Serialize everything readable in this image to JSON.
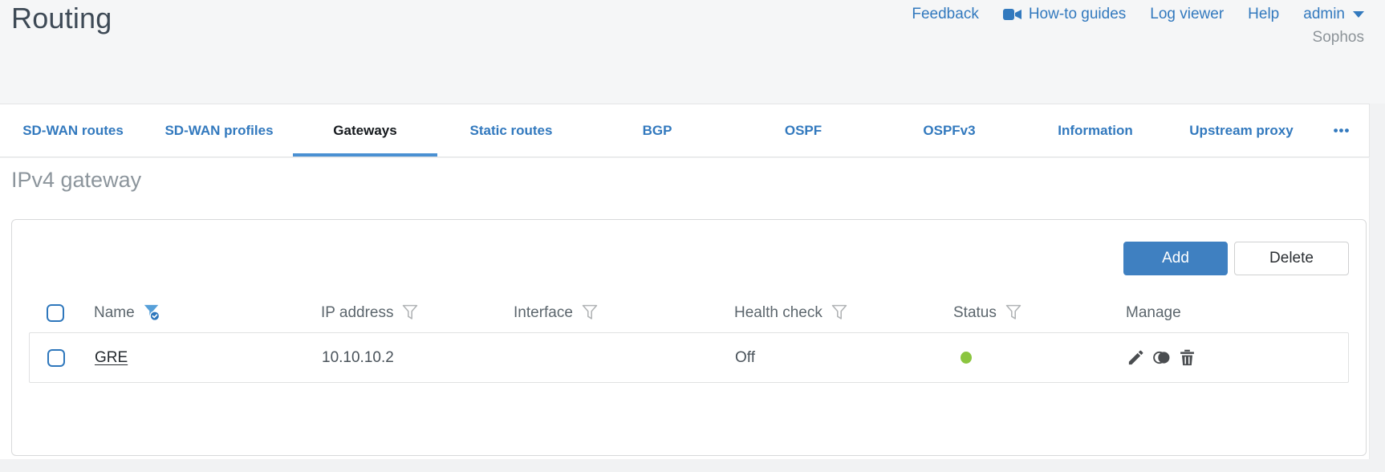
{
  "page": {
    "title": "Routing",
    "brand": "Sophos"
  },
  "header_links": {
    "feedback": "Feedback",
    "howto": "How-to guides",
    "log_viewer": "Log viewer",
    "help": "Help",
    "user": "admin"
  },
  "tabs": [
    {
      "label": "SD-WAN routes",
      "active": false
    },
    {
      "label": "SD-WAN profiles",
      "active": false
    },
    {
      "label": "Gateways",
      "active": true
    },
    {
      "label": "Static routes",
      "active": false
    },
    {
      "label": "BGP",
      "active": false
    },
    {
      "label": "OSPF",
      "active": false
    },
    {
      "label": "OSPFv3",
      "active": false
    },
    {
      "label": "Information",
      "active": false
    },
    {
      "label": "Upstream proxy",
      "active": false
    }
  ],
  "tabs_overflow": "•••",
  "section": {
    "title": "IPv4 gateway"
  },
  "toolbar": {
    "add_label": "Add",
    "delete_label": "Delete"
  },
  "table": {
    "columns": [
      {
        "label": "Name",
        "filter": "active"
      },
      {
        "label": "IP address",
        "filter": "inactive"
      },
      {
        "label": "Interface",
        "filter": "inactive"
      },
      {
        "label": "Health check",
        "filter": "inactive"
      },
      {
        "label": "Status",
        "filter": "inactive"
      },
      {
        "label": "Manage",
        "filter": "none"
      }
    ],
    "rows": [
      {
        "name": "GRE",
        "ip_address": "10.10.10.2",
        "interface": "",
        "health_check": "Off",
        "status": "up"
      }
    ]
  },
  "icons": {
    "howto": "video-camera-icon",
    "filter_active": "funnel-check-icon",
    "filter": "funnel-icon",
    "manage": [
      "edit-pencil-icon",
      "clone-icon",
      "delete-trash-icon"
    ]
  },
  "colors": {
    "accent_blue": "#3279be",
    "button_blue": "#3f80c1",
    "tab_underline": "#4a90d2",
    "status_up_green": "#8bc53f",
    "header_bg": "#f5f6f7"
  }
}
